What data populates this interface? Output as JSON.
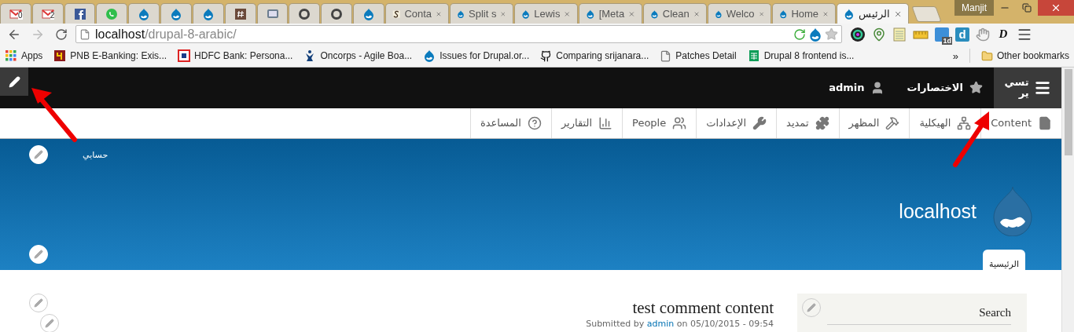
{
  "browser": {
    "tabs": [
      {
        "kind": "gmail",
        "badge": "0",
        "selected": false
      },
      {
        "kind": "gmail",
        "badge": "2",
        "selected": false
      },
      {
        "kind": "facebook",
        "selected": false
      },
      {
        "kind": "whatsapp",
        "selected": false
      },
      {
        "kind": "drupal",
        "selected": false
      },
      {
        "kind": "drupal",
        "selected": false
      },
      {
        "kind": "drupal",
        "selected": false
      },
      {
        "kind": "hash",
        "selected": false
      },
      {
        "kind": "monitor",
        "selected": false
      },
      {
        "kind": "ring",
        "selected": false
      },
      {
        "kind": "ring",
        "selected": false
      },
      {
        "kind": "drupal",
        "selected": false
      },
      {
        "kind": "swirl",
        "title": "Conta",
        "selected": false
      },
      {
        "kind": "drupal",
        "title": "Split s",
        "selected": false
      },
      {
        "kind": "drupal",
        "title": "Lewis",
        "selected": false
      },
      {
        "kind": "drupal",
        "title": "[Meta",
        "selected": false
      },
      {
        "kind": "drupal",
        "title": "Clean",
        "selected": false
      },
      {
        "kind": "drupal",
        "title": "Welco",
        "selected": false
      },
      {
        "kind": "drupal",
        "title": "Home",
        "selected": false
      },
      {
        "kind": "drupal",
        "title": "الرئيس",
        "selected": true
      }
    ],
    "profile": "Manjit",
    "url": {
      "host": "localhost",
      "path": "/drupal-8-arabic/"
    },
    "extensions": [
      {
        "kind": "camera"
      },
      {
        "kind": "pin"
      },
      {
        "kind": "notes"
      },
      {
        "kind": "ruler"
      },
      {
        "kind": "calendar",
        "badge": "1d"
      },
      {
        "kind": "tile",
        "glyph": "d"
      },
      {
        "kind": "hand"
      },
      {
        "kind": "script",
        "glyph": "D"
      }
    ],
    "bookmarks": [
      {
        "kind": "apps",
        "label": "Apps"
      },
      {
        "kind": "pnb",
        "label": "PNB E-Banking: Exis..."
      },
      {
        "kind": "hdfc",
        "label": "HDFC Bank: Persona..."
      },
      {
        "kind": "oncorps",
        "label": "Oncorps - Agile Boa..."
      },
      {
        "kind": "drupal",
        "label": "Issues for Drupal.or..."
      },
      {
        "kind": "github",
        "label": "Comparing srijanara..."
      },
      {
        "kind": "file",
        "label": "Patches Detail"
      },
      {
        "kind": "sheet",
        "label": "Drupal 8 frontend is..."
      }
    ],
    "bookmarks_more": "»",
    "other_bookmarks": "Other bookmarks"
  },
  "admin_toolbar": {
    "manage_lines": [
      "تسي",
      "ير"
    ],
    "shortcuts": "الاختصارات",
    "user": "admin"
  },
  "tray": [
    {
      "kind": "file",
      "label": "Content"
    },
    {
      "kind": "sitemap",
      "label": "الهيكلية"
    },
    {
      "kind": "hammer",
      "label": "المظهر"
    },
    {
      "kind": "puzzle",
      "label": "تمديد"
    },
    {
      "kind": "wrench",
      "label": "الإعدادات"
    },
    {
      "kind": "people",
      "label": "People"
    },
    {
      "kind": "chart",
      "label": "التقارير"
    },
    {
      "kind": "help",
      "label": "المساعدة"
    }
  ],
  "header": {
    "account_link": "حسابي",
    "site_name": "localhost",
    "tabs": [
      {
        "label": "الرئيسية",
        "selected": true
      }
    ]
  },
  "article": {
    "title": "test comment content",
    "submitted_prefix": "Submitted by",
    "author": "admin",
    "submitted_suffix": "on",
    "date": "05/10/2015 - 09:54"
  },
  "sidebar": {
    "block_title": "Search"
  }
}
